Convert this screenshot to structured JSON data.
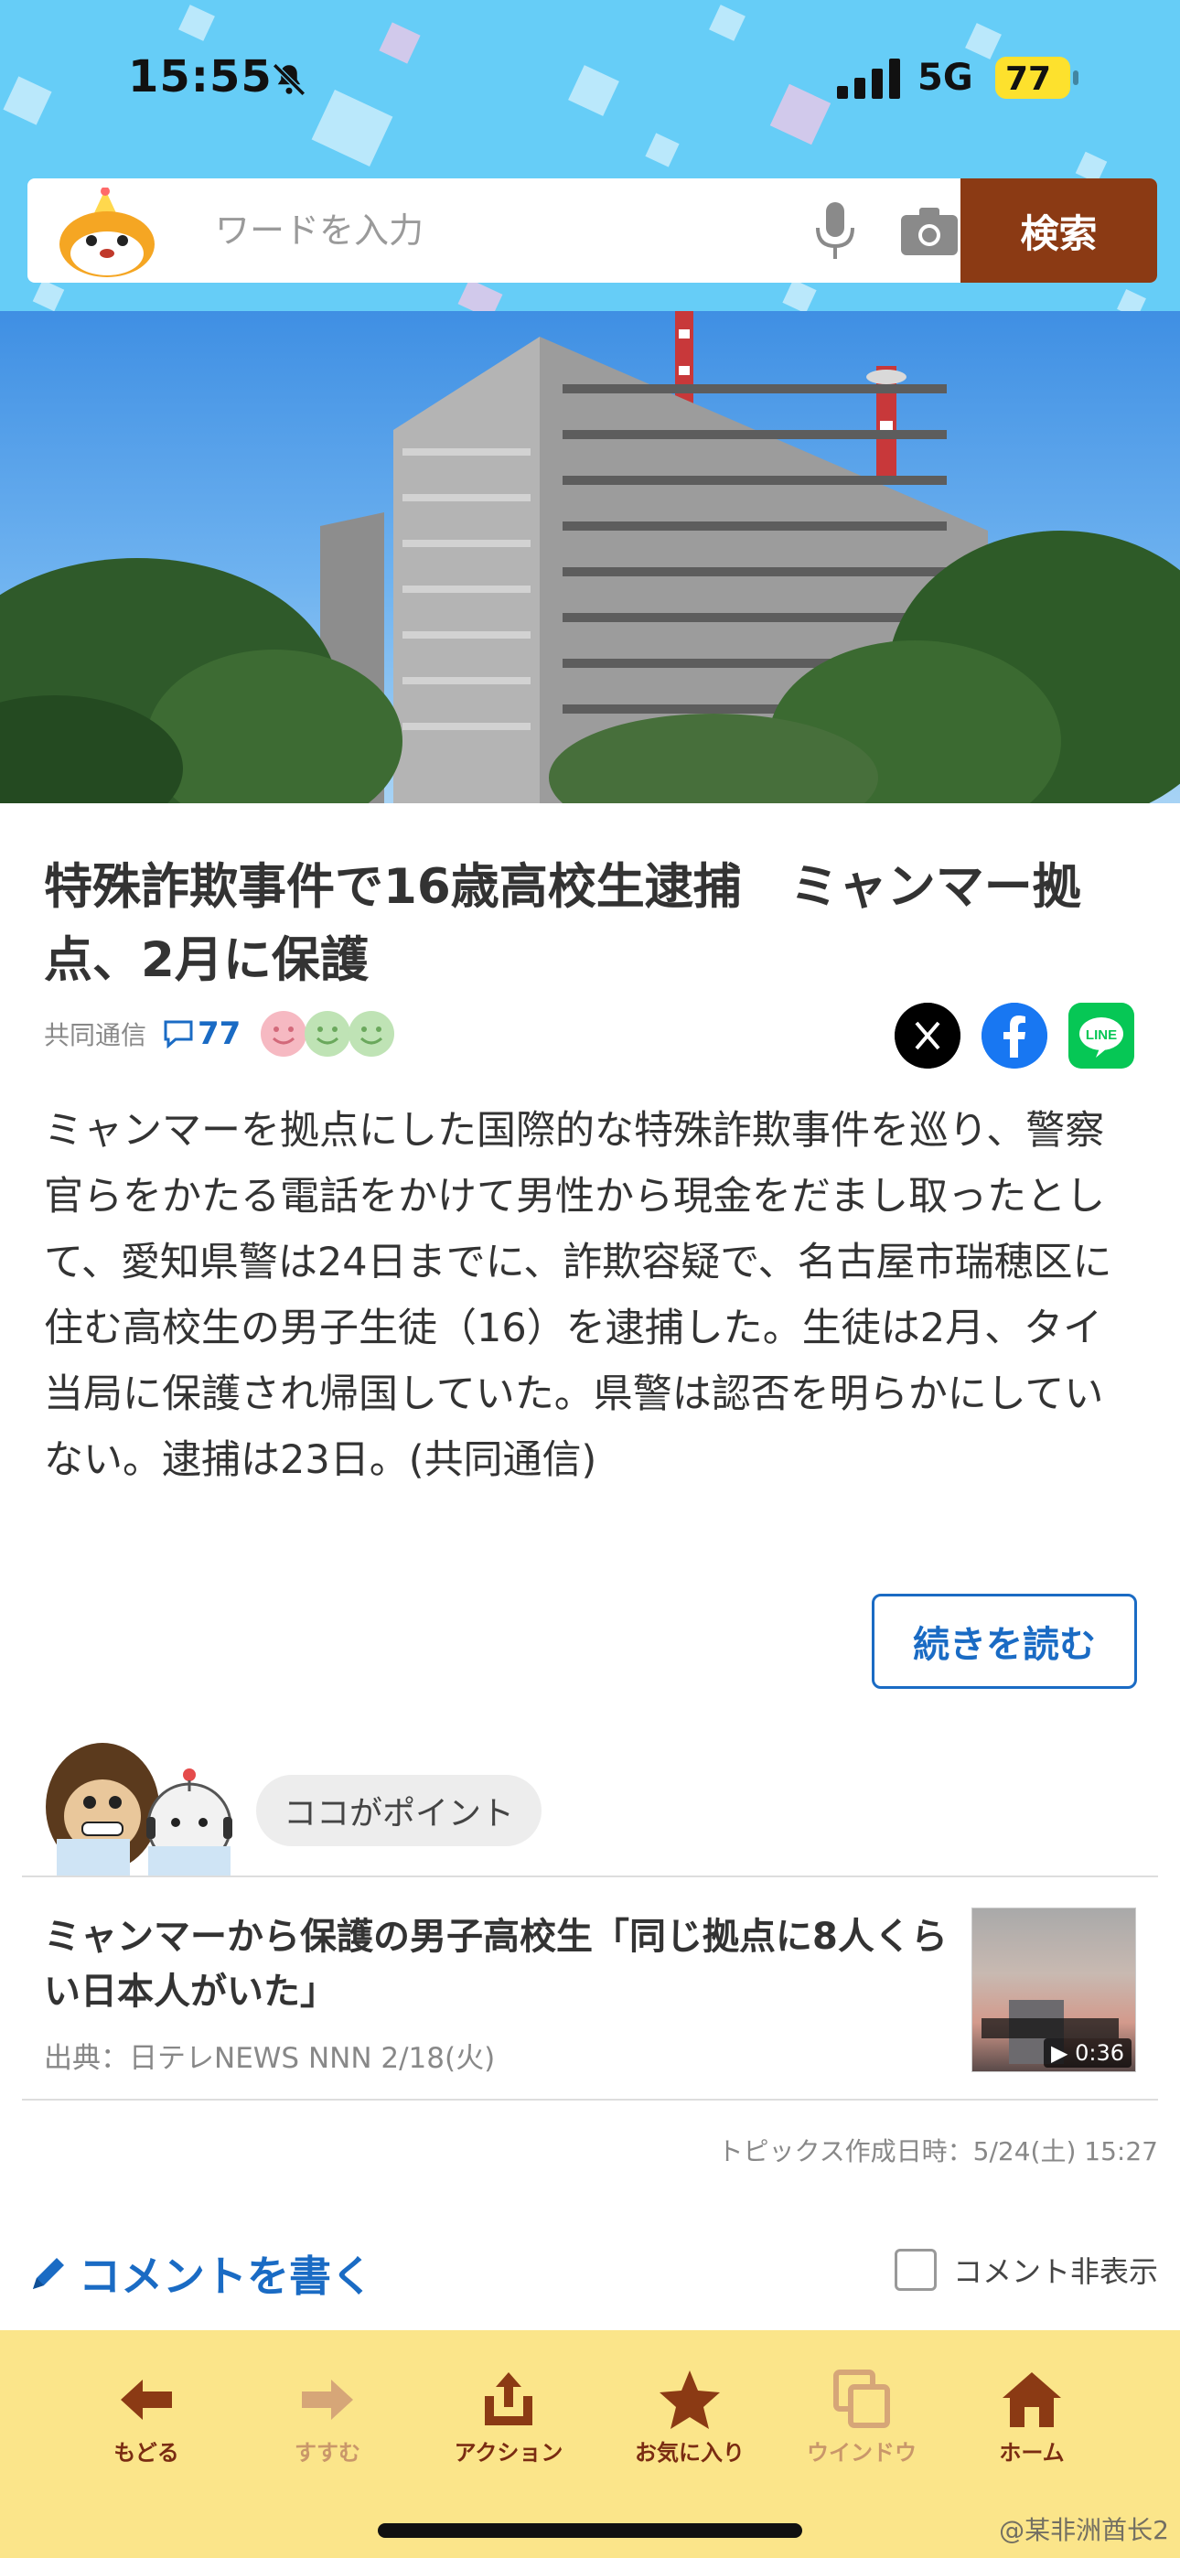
{
  "status_bar": {
    "time": "15:55",
    "network": "5G",
    "battery": "77"
  },
  "search": {
    "placeholder": "ワードを入力",
    "button_label": "検索"
  },
  "article": {
    "title": "特殊詐欺事件で16歳高校生逮捕　ミャンマー拠点、2月に保護",
    "source": "共同通信",
    "comment_count": "77",
    "body": "ミャンマーを拠点にした国際的な特殊詐欺事件を巡り、警察官らをかたる電話をかけて男性から現金をだまし取ったとして、愛知県警は24日までに、詐欺容疑で、名古屋市瑞穂区に住む高校生の男子生徒（16）を逮捕した。生徒は2月、タイ当局に保護され帰国していた。県警は認否を明らかにしていない。逮捕は23日。(共同通信)",
    "read_more_label": "続きを読む"
  },
  "point": {
    "bubble_label": "ココがポイント",
    "related": {
      "title": "ミャンマーから保護の男子高校生「同じ拠点に8人くらい日本人がいた」",
      "source": "出典：日テレNEWS NNN 2/18(火)",
      "video_duration": "▶ 0:36"
    }
  },
  "topic_date": "トピックス作成日時：5/24(土) 15:27",
  "comments": {
    "write_label": "コメントを書く",
    "hide_label": "コメント非表示"
  },
  "toolbar": {
    "items": [
      {
        "label": "もどる",
        "icon": "back-arrow-icon"
      },
      {
        "label": "すすむ",
        "icon": "forward-arrow-icon"
      },
      {
        "label": "アクション",
        "icon": "share-icon"
      },
      {
        "label": "お気に入り",
        "icon": "star-icon"
      },
      {
        "label": "ウインドウ",
        "icon": "window-icon"
      },
      {
        "label": "ホーム",
        "icon": "home-icon"
      }
    ]
  },
  "watermark": "@某非洲酋长2",
  "colors": {
    "header_bg": "#66cdf7",
    "search_button": "#8b3a14",
    "link_blue": "#1a6bc4",
    "toolbar_bg": "#fbe58a",
    "toolbar_icon": "#7a2c12",
    "toolbar_icon_disabled": "#d6a678"
  }
}
